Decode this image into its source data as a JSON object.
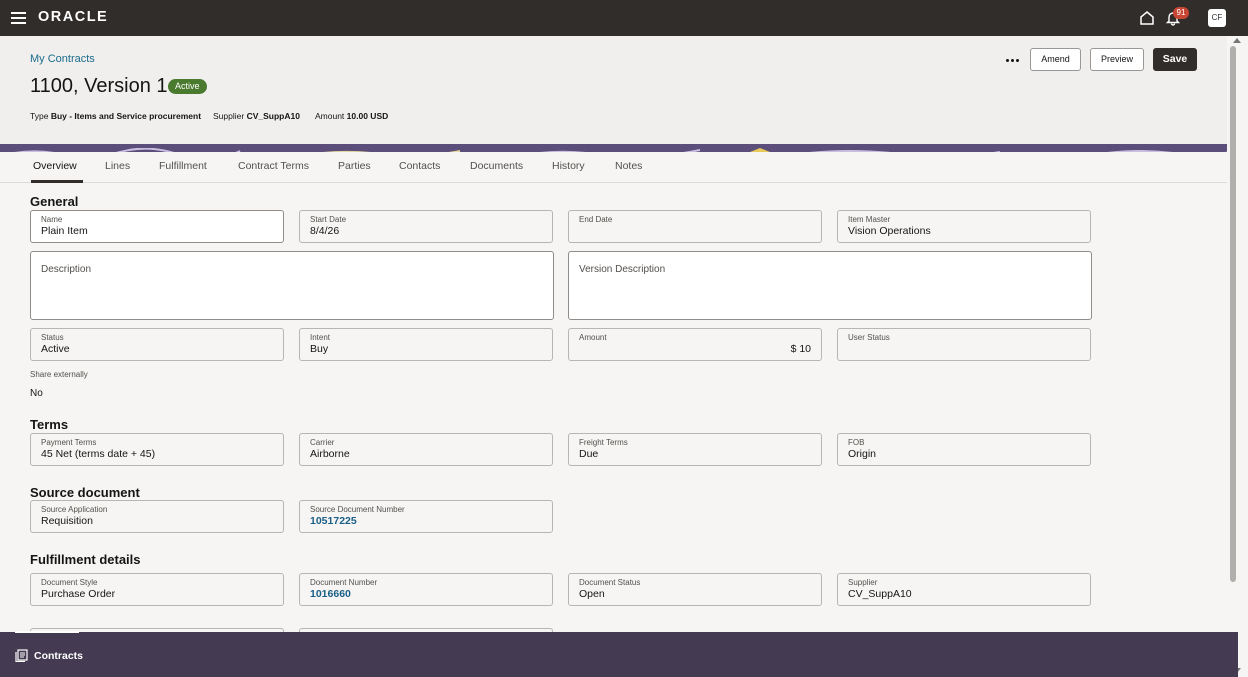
{
  "app": {
    "logo": "ORACLE",
    "notification_count": "91",
    "user_initials": "CF"
  },
  "header": {
    "breadcrumb": "My Contracts",
    "title": "1100, Version 1",
    "status": "Active",
    "meta": [
      {
        "label": "Type",
        "value": "Buy - Items and Service procurement"
      },
      {
        "label": "Supplier",
        "value": "CV_SuppA10"
      },
      {
        "label": "Amount",
        "value": "10.00 USD"
      }
    ],
    "buttons": {
      "amend": "Amend",
      "preview": "Preview",
      "save": "Save"
    }
  },
  "tabs": [
    "Overview",
    "Lines",
    "Fulfillment",
    "Contract Terms",
    "Parties",
    "Contacts",
    "Documents",
    "History",
    "Notes"
  ],
  "general": {
    "title": "General",
    "name": {
      "label": "Name",
      "value": "Plain Item"
    },
    "start_date": {
      "label": "Start Date",
      "value": "8/4/26"
    },
    "end_date": {
      "label": "End Date",
      "value": ""
    },
    "item_master": {
      "label": "Item Master",
      "value": "Vision Operations"
    },
    "description": {
      "label": "Description",
      "value": ""
    },
    "version_description": {
      "label": "Version Description",
      "value": ""
    },
    "status": {
      "label": "Status",
      "value": "Active"
    },
    "intent": {
      "label": "Intent",
      "value": "Buy"
    },
    "amount": {
      "label": "Amount",
      "value": "$ 10"
    },
    "user_status": {
      "label": "User Status",
      "value": ""
    },
    "share_externally": {
      "label": "Share externally",
      "value": "No"
    }
  },
  "terms": {
    "title": "Terms",
    "payment_terms": {
      "label": "Payment Terms",
      "value": "45 Net (terms date + 45)"
    },
    "carrier": {
      "label": "Carrier",
      "value": "Airborne"
    },
    "freight_terms": {
      "label": "Freight Terms",
      "value": "Due"
    },
    "fob": {
      "label": "FOB",
      "value": "Origin"
    }
  },
  "source_document": {
    "title": "Source document",
    "source_application": {
      "label": "Source Application",
      "value": "Requisition"
    },
    "source_document_number": {
      "label": "Source Document Number",
      "value": "10517225"
    }
  },
  "fulfillment": {
    "title": "Fulfillment details",
    "document_style": {
      "label": "Document Style",
      "value": "Purchase Order"
    },
    "document_number": {
      "label": "Document Number",
      "value": "1016660"
    },
    "document_status": {
      "label": "Document Status",
      "value": "Open"
    },
    "supplier": {
      "label": "Supplier",
      "value": "CV_SuppA10"
    }
  },
  "dock": {
    "label": "Contracts"
  },
  "colors": {
    "topbar": "#312d2a",
    "badge_active": "#4a7a2e",
    "link": "#1a6b8c",
    "dock": "#443a52",
    "notification": "#c74634"
  }
}
